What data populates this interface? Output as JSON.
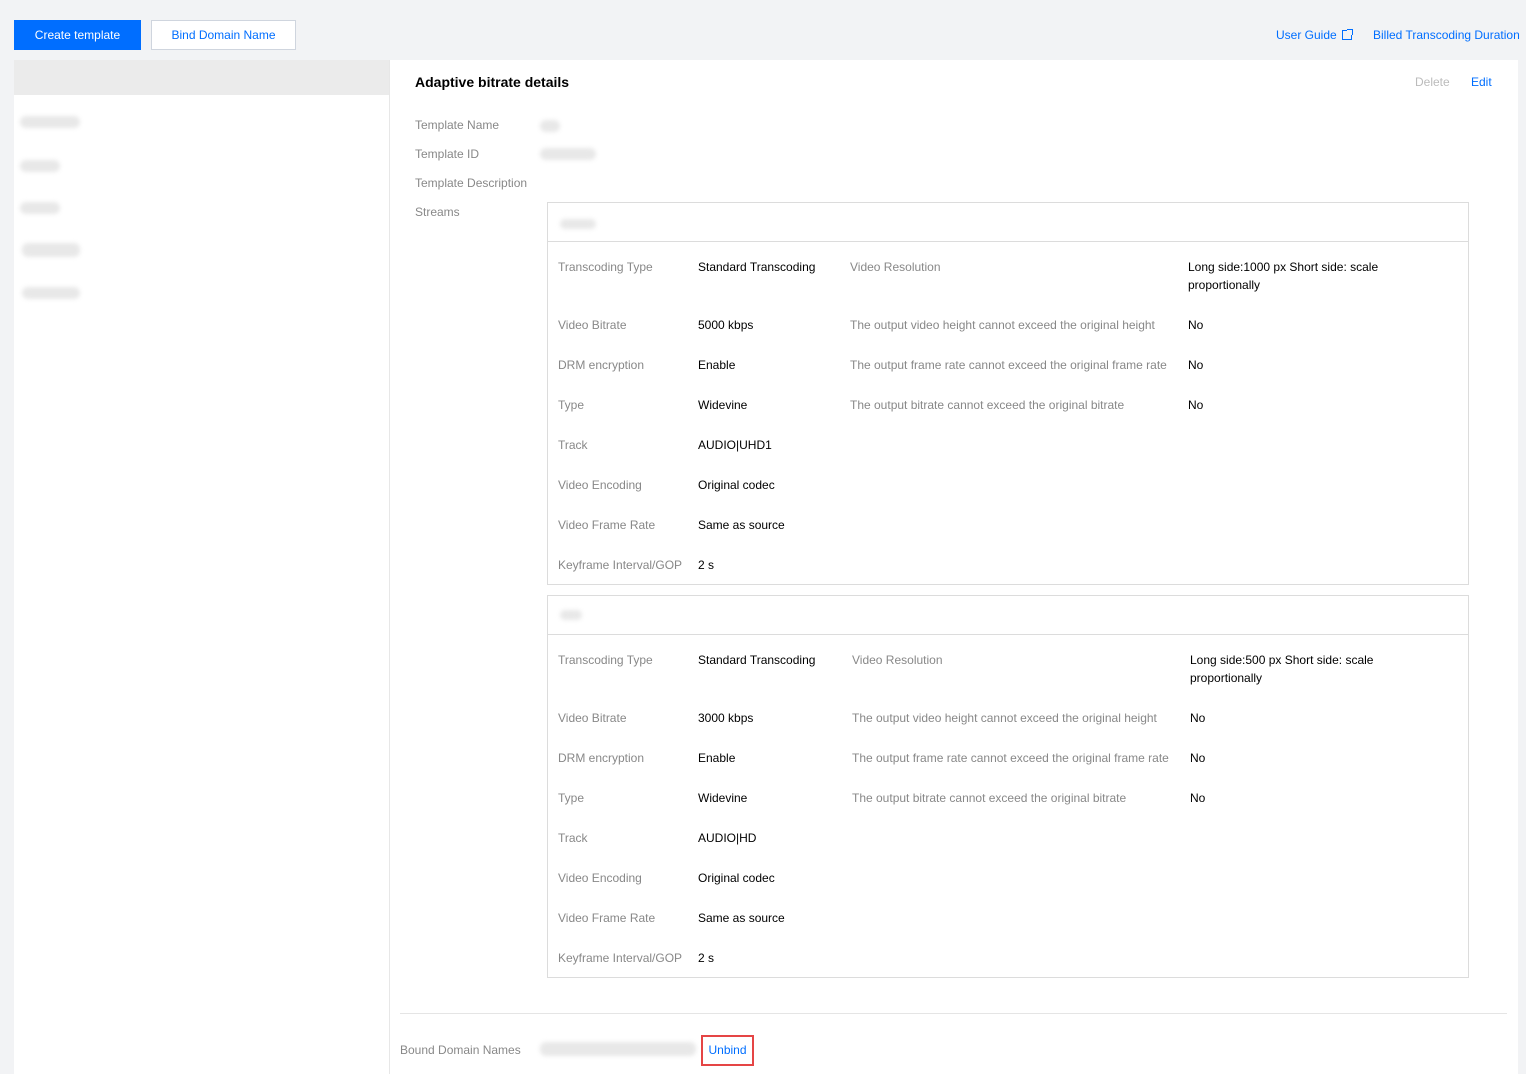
{
  "toolbar": {
    "create_template": "Create template",
    "bind_domain": "Bind Domain Name",
    "user_guide": "User Guide",
    "billed_duration": "Billed Transcoding Duration"
  },
  "detail": {
    "title": "Adaptive bitrate details",
    "delete_label": "Delete",
    "edit_label": "Edit",
    "labels": {
      "template_name": "Template Name",
      "template_id": "Template ID",
      "template_description": "Template Description",
      "streams": "Streams"
    }
  },
  "streams": [
    {
      "left": [
        {
          "label": "Transcoding Type",
          "value": "Standard Transcoding"
        },
        {
          "label": "Video Bitrate",
          "value": "5000 kbps"
        },
        {
          "label": "DRM encryption",
          "value": "Enable"
        },
        {
          "label": "Type",
          "value": "Widevine"
        },
        {
          "label": "Track",
          "value": "AUDIO|UHD1"
        },
        {
          "label": "Video Encoding",
          "value": "Original codec"
        },
        {
          "label": "Video Frame Rate",
          "value": "Same as source"
        },
        {
          "label": "Keyframe Interval/GOP",
          "value": "2 s"
        }
      ],
      "right": [
        {
          "label": "Video Resolution",
          "value": "Long side:1000 px Short side: scale proportionally"
        },
        {
          "label": "The output video height cannot exceed the original height",
          "value": "No"
        },
        {
          "label": "The output frame rate cannot exceed the original frame rate",
          "value": "No"
        },
        {
          "label": "The output bitrate cannot exceed the original bitrate",
          "value": "No"
        }
      ]
    },
    {
      "left": [
        {
          "label": "Transcoding Type",
          "value": "Standard Transcoding"
        },
        {
          "label": "Video Bitrate",
          "value": "3000 kbps"
        },
        {
          "label": "DRM encryption",
          "value": "Enable"
        },
        {
          "label": "Type",
          "value": "Widevine"
        },
        {
          "label": "Track",
          "value": "AUDIO|HD"
        },
        {
          "label": "Video Encoding",
          "value": "Original codec"
        },
        {
          "label": "Video Frame Rate",
          "value": "Same as source"
        },
        {
          "label": "Keyframe Interval/GOP",
          "value": "2 s"
        }
      ],
      "right": [
        {
          "label": "Video Resolution",
          "value": "Long side:500 px Short side: scale proportionally"
        },
        {
          "label": "The output video height cannot exceed the original height",
          "value": "No"
        },
        {
          "label": "The output frame rate cannot exceed the original frame rate",
          "value": "No"
        },
        {
          "label": "The output bitrate cannot exceed the original bitrate",
          "value": "No"
        }
      ]
    }
  ],
  "bound": {
    "label": "Bound Domain Names",
    "unbind_label": "Unbind"
  },
  "colors": {
    "accent": "#006eff",
    "highlight_border": "#e54545"
  }
}
